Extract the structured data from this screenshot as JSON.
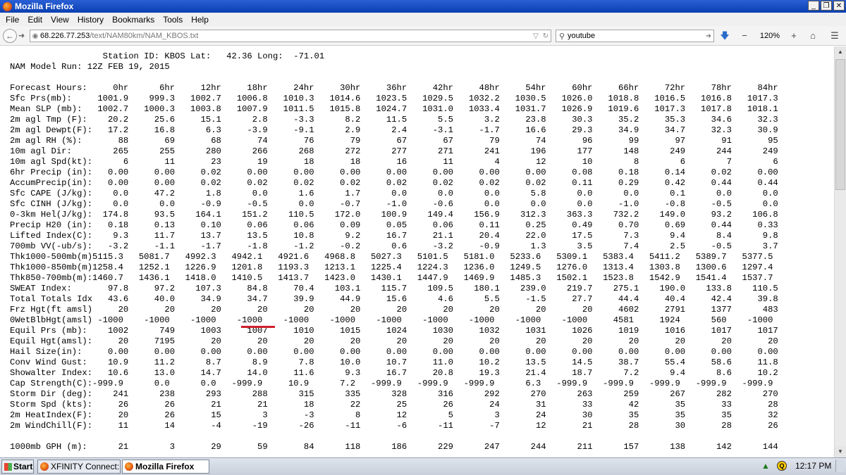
{
  "window": {
    "title": "Mozilla Firefox",
    "controls": [
      "_",
      "❐",
      "✕"
    ]
  },
  "menu": [
    "File",
    "Edit",
    "View",
    "History",
    "Bookmarks",
    "Tools",
    "Help"
  ],
  "nav": {
    "url_host": "68.226.77.253",
    "url_path": "/text/NAM80km/NAM_KBOS.txt",
    "search_value": "youtube",
    "zoom": "120%"
  },
  "document": {
    "text": "                  Station ID: KBOS Lat:   42.36 Long:  -71.01\nNAM Model Run: 12Z FEB 19, 2015\n\nForecast Hours:     0hr      6hr     12hr     18hr     24hr     30hr     36hr     42hr     48hr     54hr     60hr     66hr     72hr     78hr     84hr\nSfc Prs(mb):     1001.9    999.3   1002.7   1006.8   1010.3   1014.6   1023.5   1029.5   1032.2   1030.5   1026.0   1018.8   1016.5   1016.8   1017.3\nMean SLP (mb):   1002.7   1000.3   1003.8   1007.9   1011.5   1015.8   1024.7   1031.0   1033.4   1031.7   1026.9   1019.6   1017.3   1017.8   1018.1\n2m agl Tmp (F):    20.2     25.6     15.1      2.8     -3.3      8.2     11.5      5.5      3.2     23.8     30.3     35.2     35.3     34.6     32.3\n2m agl Dewpt(F):   17.2     16.8      6.3     -3.9     -9.1      2.9      2.4     -3.1     -1.7     16.6     29.3     34.9     34.7     32.3     30.9\n2m agl RH (%):       88       69       68       74       76       79       67       67       79       74       96       99       97       91       95\n10m agl Dir:        265      255      280      266      268      272      277      271      241      196      177      148      249      244      249\n10m agl Spd(kt):      6       11       23       19       18       18       16       11        4       12       10        8        6        7        6\n6hr Precip (in):   0.00     0.00     0.02     0.00     0.00     0.00     0.00     0.00     0.00     0.00     0.08     0.18     0.14     0.02     0.00\nAccumPrecip(in):   0.00     0.00     0.02     0.02     0.02     0.02     0.02     0.02     0.02     0.02     0.11     0.29     0.42     0.44     0.44\nSfc CAPE (J/kg):    0.0     47.2      1.8      0.0      1.6      1.7      0.0      0.0      0.0      5.8      0.0      0.0      0.1      0.0      0.0\nSfc CINH (J/kg):    0.0      0.0     -0.9     -0.5      0.0     -0.7     -1.0     -0.6      0.0      0.0      0.0     -1.0     -0.8     -0.5      0.0\n0-3km Hel(J/kg):  174.8     93.5    164.1    151.2    110.5    172.0    100.9    149.4    156.9    312.3    363.3    732.2    149.0     93.2    106.8\nPrecip H20 (in):   0.18     0.13     0.10     0.06     0.06     0.09     0.05     0.06     0.11     0.25     0.49     0.70     0.69     0.44     0.33\nLifted Index(C):    9.3     11.7     13.7     13.5     10.8      9.2     16.7     21.1     20.4     22.0     17.5      7.3      9.4      8.4      9.8\n700mb VV(-ub/s):   -3.2     -1.1     -1.7     -1.8     -1.2     -0.2      0.6     -3.2     -0.9      1.3      3.5      7.4      2.5     -0.5      3.7\nThk1000-500mb(m)5115.3   5081.7   4992.3   4942.1   4921.6   4968.8   5027.3   5101.5   5181.0   5233.6   5309.1   5383.4   5411.2   5389.7   5377.5\nThk1000-850mb(m)1258.4   1252.1   1226.9   1201.8   1193.3   1213.1   1225.4   1224.3   1236.0   1249.5   1276.0   1313.4   1303.8   1300.6   1297.4\nThk850-700mb(m):1460.7   1436.1   1418.0   1410.5   1413.7   1423.0   1430.1   1447.9   1469.9   1485.3   1502.1   1523.8   1542.9   1541.4   1537.7\nSWEAT Index:       97.8     97.2    107.3     84.8     70.4    103.1    115.7    109.5    180.1    239.0    219.7    275.1    190.0    133.8    110.5\nTotal Totals Idx   43.6     40.0     34.9     34.7     39.9     44.9     15.6      4.6      5.5     -1.5     27.7     44.4     40.4     42.4     39.8\nFrz Hgt(ft amsl)     20       20       20       20       20       20       20       20       20       20       20     4602     2791     1377      483\n0WetBlbHgt(amsl) -1000    -1000    -1000    -1000    -1000    -1000    -1000    -1000    -1000    -1000    -1000     4581     1924      560    -1000\nEquil Prs (mb):    1002      749     1003     1007     1010     1015     1024     1030     1032     1031     1026     1019     1016     1017     1017\nEquil Hgt(amsl):     20     7195       20       20       20       20       20       20       20       20       20       20       20       20       20\nHail Size(in):     0.00     0.00     0.00     0.00     0.00     0.00     0.00     0.00     0.00     0.00     0.00     0.00     0.00     0.00     0.00\nConv Wind Gust:    10.9     11.2      8.7      8.9      7.8     10.0     10.7     11.0     10.2     13.5     14.5     38.7     55.4     58.6     11.8\nShowalter Index:   10.6     13.0     14.7     14.0     11.6      9.3     16.7     20.8     19.3     21.4     18.7      7.2      9.4      8.6     10.2\nCap Strength(C):-999.9      0.0      0.0   -999.9     10.9      7.2   -999.9   -999.9   -999.9      6.3   -999.9   -999.9   -999.9   -999.9   -999.9\nStorm Dir (deg):    241      238      293      288      315      335      328      316      292      270      263      259      267      282      270\nStorm Spd (kts):     26       26       21       21       18       22       25       26       24       31       33       42       35       33       28\n2m HeatIndex(F):     20       26       15        3       -3        8       12        5        3       24       30       35       35       35       32\n2m WindChill(F):     11       14       -4      -19      -26      -11       -6      -11       -7       12       21       28       30       28       26\n\n1000mb GPH (m):      21        3       29       59       84      118      186      229      247      244      211      157      138      142      144"
  },
  "taskbar": {
    "start": "Start",
    "tasks": [
      "XFINITY Connect:...",
      "Mozilla Firefox"
    ],
    "clock": "12:17 PM"
  },
  "colors": {
    "titlebar": "#0a3fb0",
    "annotation_underline": "#d0202a"
  }
}
